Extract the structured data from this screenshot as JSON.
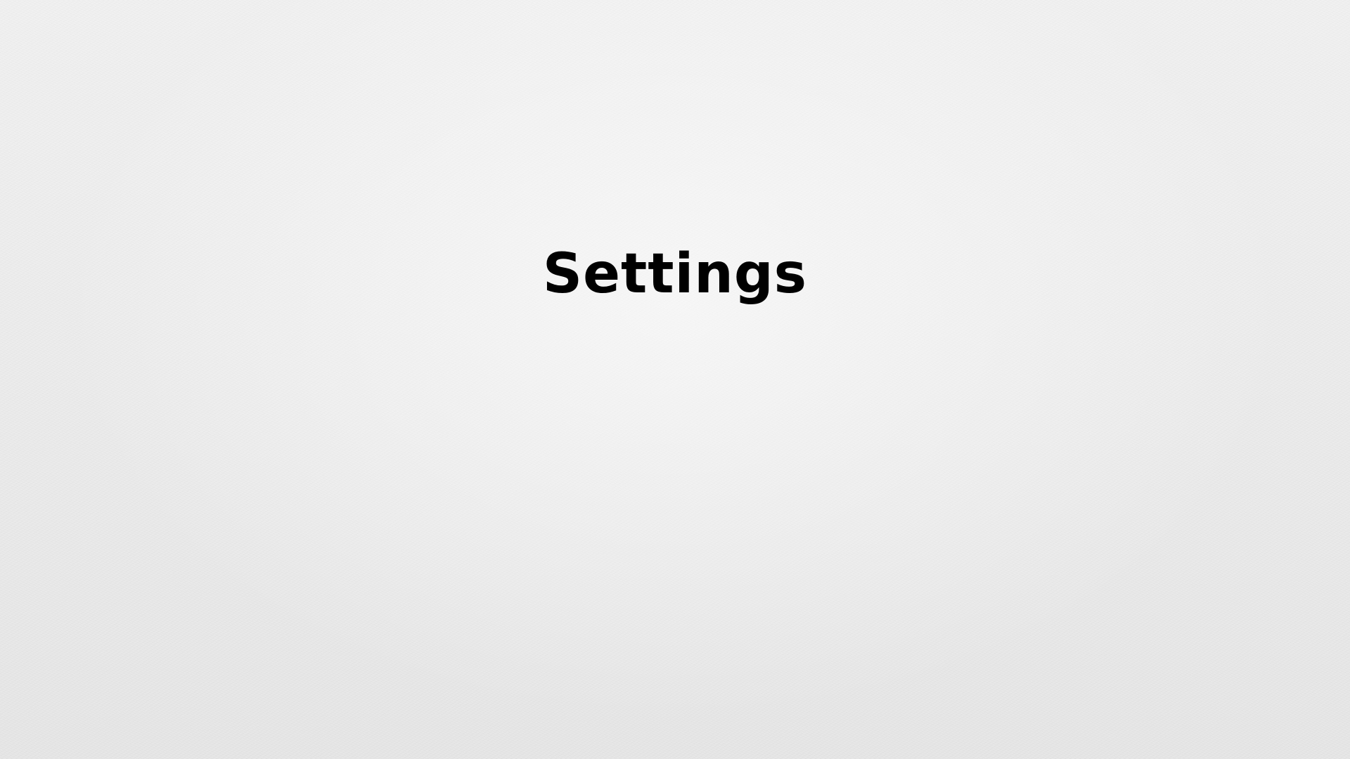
{
  "page": {
    "title": "Settings",
    "background_color": "#ececec",
    "title_color": "#000000"
  }
}
